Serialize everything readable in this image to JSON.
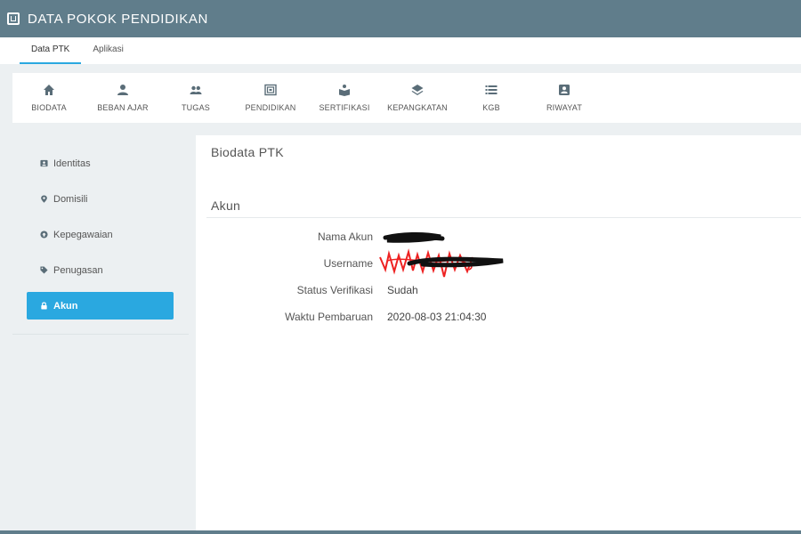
{
  "header": {
    "title": "DATA POKOK PENDIDIKAN",
    "logo_icon": "app-logo-icon"
  },
  "tabs": [
    {
      "label": "Data PTK",
      "active": true
    },
    {
      "label": "Aplikasi",
      "active": false
    }
  ],
  "menu": [
    {
      "label": "BIODATA",
      "icon": "home-icon"
    },
    {
      "label": "BEBAN AJAR",
      "icon": "person-icon"
    },
    {
      "label": "TUGAS",
      "icon": "people-icon"
    },
    {
      "label": "PENDIDIKAN",
      "icon": "certificate-frame-icon"
    },
    {
      "label": "SERTIFIKASI",
      "icon": "open-book-icon"
    },
    {
      "label": "KEPANGKATAN",
      "icon": "layers-icon"
    },
    {
      "label": "KGB",
      "icon": "list-icon"
    },
    {
      "label": "RIWAYAT",
      "icon": "id-badge-icon"
    }
  ],
  "sidebar": {
    "items": [
      {
        "label": "Identitas",
        "icon": "id-card-icon",
        "active": false
      },
      {
        "label": "Domisili",
        "icon": "map-marker-icon",
        "active": false
      },
      {
        "label": "Kepegawaian",
        "icon": "circle-arrow-icon",
        "active": false
      },
      {
        "label": "Penugasan",
        "icon": "tag-icon",
        "active": false
      },
      {
        "label": "Akun",
        "icon": "lock-icon",
        "active": true
      }
    ]
  },
  "main": {
    "title": "Biodata PTK",
    "section_title": "Akun",
    "fields": [
      {
        "label": "Nama Akun",
        "value": "",
        "redacted": true
      },
      {
        "label": "Username",
        "value": "",
        "redacted": true
      },
      {
        "label": "Status Verifikasi",
        "value": "Sudah",
        "redacted": false
      },
      {
        "label": "Waktu Pembaruan",
        "value": "2020-08-03 21:04:30",
        "redacted": false
      }
    ]
  },
  "colors": {
    "header": "#607d8b",
    "accent": "#2aa8e0",
    "icon": "#5a6d78"
  }
}
